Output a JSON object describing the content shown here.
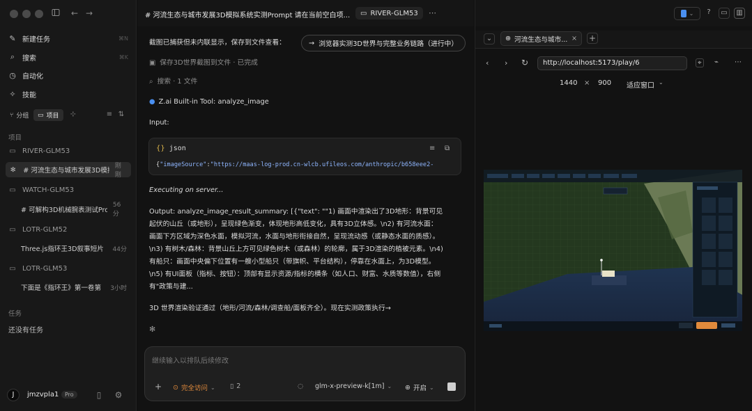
{
  "window": {
    "title": "# 河流生态与城市发展3D模拟系统实测Prompt 请在当前空白项...",
    "folder_chip": "RIVER-GLM53"
  },
  "sidebar": {
    "nav": [
      {
        "label": "新建任务",
        "icon": "compose-icon",
        "shortcut": "⌘N"
      },
      {
        "label": "搜索",
        "icon": "search-icon",
        "shortcut": "⌘K"
      },
      {
        "label": "自动化",
        "icon": "clock-icon",
        "shortcut": ""
      },
      {
        "label": "技能",
        "icon": "skills-icon",
        "shortcut": ""
      }
    ],
    "segment": {
      "group": "分组",
      "project": "项目"
    },
    "projects_label": "项目",
    "projects": [
      {
        "name": "RIVER-GLM53",
        "tasks": [
          {
            "name": "# 河流生态与城市发展3D模拟",
            "time": "刚刚",
            "active": true
          }
        ]
      },
      {
        "name": "WATCH-GLM53",
        "tasks": [
          {
            "name": "# 可解构3D机械腕表测试Pro",
            "time": "56分",
            "active": false
          }
        ]
      },
      {
        "name": "LOTR-GLM52",
        "tasks": [
          {
            "name": "Three.js指环王3D叙事短片",
            "time": "44分",
            "active": false
          }
        ]
      },
      {
        "name": "LOTR-GLM53",
        "tasks": [
          {
            "name": "下面是《指环王》第一卷第",
            "time": "3小时",
            "active": false
          }
        ]
      }
    ],
    "tasks_label": "任务",
    "no_tasks": "还没有任务",
    "user": {
      "initial": "J",
      "name": "jmzvpla1",
      "badge": "Pro"
    }
  },
  "chat": {
    "screenshot_note": "截图已捕获但未内联显示，保存到文件查看：",
    "browser_chip": "浏览器实测3D世界与完整业务链路（进行中）",
    "save_step": "保存3D世界截图到文件 · 已完成",
    "search_step": "搜索 · 1 文件",
    "tool_header": "Z.ai Built-in Tool: analyze_image",
    "input_label": "Input:",
    "code_lang": "json",
    "code_key": "\"imageSource\"",
    "code_value": "\"https://maas-log-prod.cn-wlcb.ufileos.com/anthropic/b658eee2-",
    "executing": "Executing on server...",
    "output_lines": [
      "Output: analyze_image_result_summary: [{\"text\": \"\"1) 画面中渲染出了3D地形：背景可见",
      "起伏的山丘（或地形），呈现绿色渐变，体现地形高低变化，具有3D立体感。\\n2) 有河流水面：",
      "画面下方区域为深色水面，模拟河流，水面与地形衔接自然，呈现流动感（或静态水面的质感）。",
      "\\n3) 有树木/森林：背景山丘上方可见绿色树木（或森林）的轮廓，属于3D渲染的植被元素。\\n4)",
      "有船只：画面中央偏下位置有一艘小型船只（带旗帜、平台结构），停靠在水面上，为3D模型。",
      "\\n5) 有UI面板（指标、按钮）：顶部有显示资源/指标的横条（如人口、财富、水质等数值），右侧",
      "有\"政策与建..."
    ],
    "summary_line": "3D 世界渲染验证通过（地形/河流/森林/调查船/面板齐全）。现在实测政策执行→"
  },
  "composer": {
    "placeholder": "继续输入以排队后续修改",
    "access": "完全访问",
    "count": "2",
    "model": "glm-x-preview-k[1m]",
    "toggle": "开启"
  },
  "browser": {
    "tab_title": "河流生态与城市...",
    "url": "http://localhost:5173/play/6",
    "width": "1440",
    "times": "×",
    "height": "900",
    "fit": "适应窗口"
  },
  "colors": {
    "accent_orange": "#e08a3c",
    "blue_icon": "#4a8ff0"
  }
}
